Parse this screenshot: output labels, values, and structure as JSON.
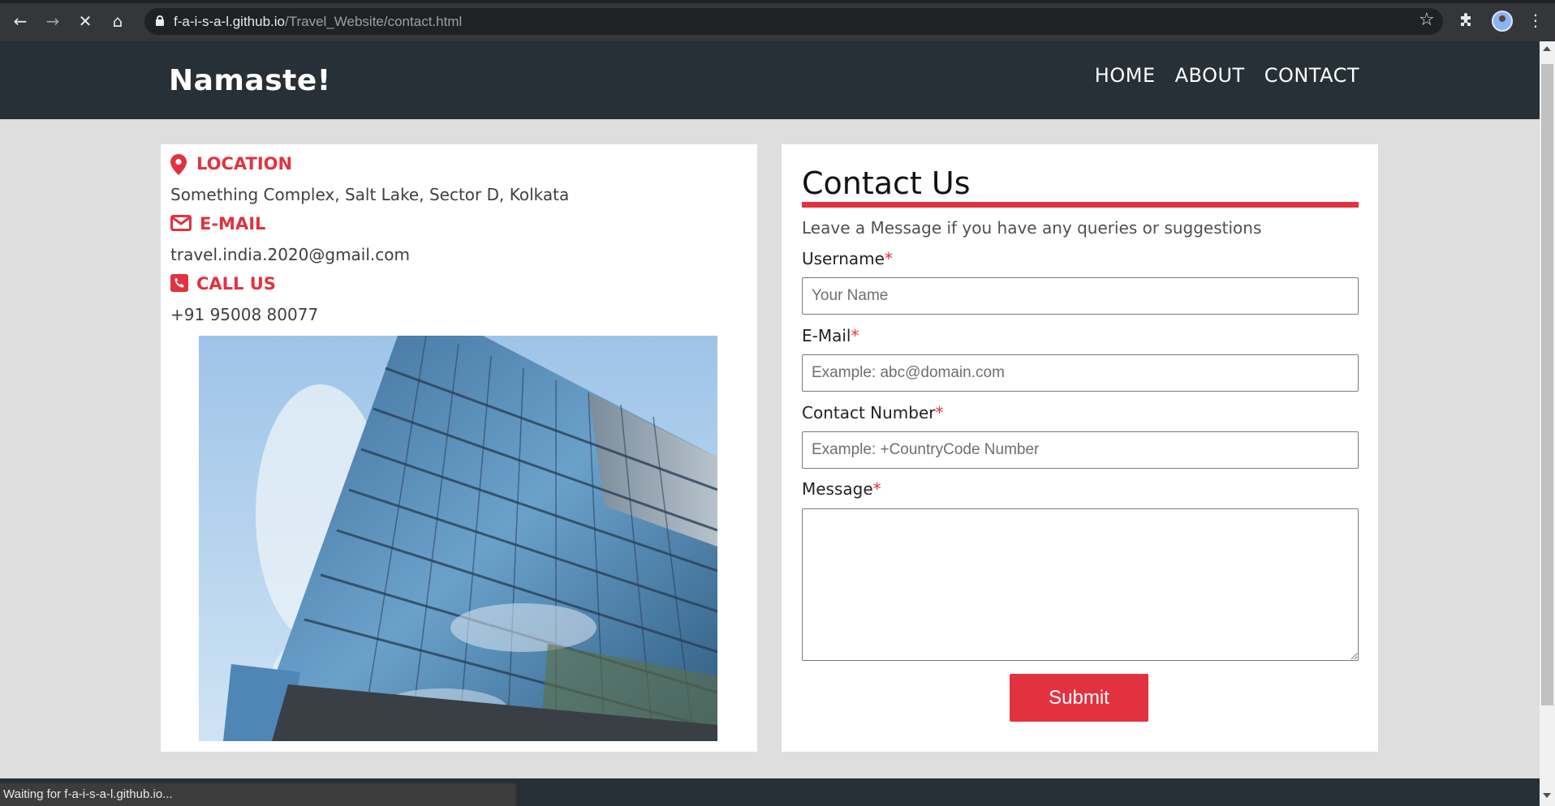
{
  "browser": {
    "url_domain": "f-a-i-s-a-l.github.io",
    "url_path": "/Travel_Website/contact.html",
    "status_text": "Waiting for f-a-i-s-a-l.github.io..."
  },
  "header": {
    "brand": "Namaste!",
    "nav": [
      "HOME",
      "ABOUT",
      "CONTACT"
    ]
  },
  "info": {
    "location_heading": "LOCATION",
    "location_text": "Something Complex, Salt Lake, Sector D, Kolkata",
    "email_heading": "E-MAIL",
    "email_text": "travel.india.2020@gmail.com",
    "call_heading": "CALL US",
    "call_text": "+91 95008 80077"
  },
  "form": {
    "title": "Contact Us",
    "subtitle": "Leave a Message if you have any queries or suggestions",
    "required_marker": "*",
    "username_label": "Username",
    "username_placeholder": "Your Name",
    "email_label": "E-Mail",
    "email_placeholder": "Example: abc@domain.com",
    "contact_label": "Contact Number",
    "contact_placeholder": "Example: +CountryCode Number",
    "message_label": "Message",
    "submit_label": "Submit"
  },
  "colors": {
    "accent": "#e23240",
    "header_bg": "#263036",
    "page_bg": "#dedede"
  }
}
